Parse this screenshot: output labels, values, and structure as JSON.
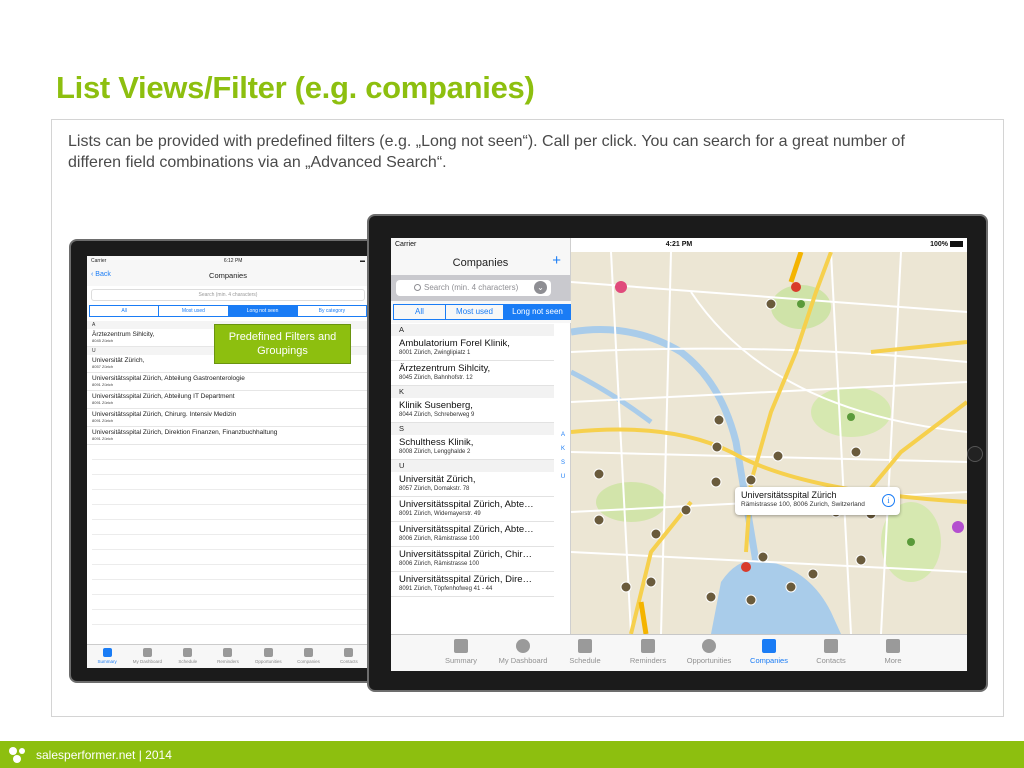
{
  "slide": {
    "title": "List Views/Filter (e.g. companies)",
    "intro": "Lists can be provided with predefined filters (e.g. „Long not seen“). Call per click. You can search for a great number of differen field combinations via an „Advanced Search“.",
    "callout": "Predefined Filters and Groupings",
    "footer": "salesperformer.net  |  2014"
  },
  "small_ipad": {
    "status_left": "Carrier",
    "status_time": "6:12 PM",
    "back_label": "Back",
    "title": "Companies",
    "search_placeholder": "Search (min. 4 characters)",
    "segments": [
      "All",
      "Most used",
      "Long not seen",
      "By category"
    ],
    "active_segment": 2,
    "sections": [
      {
        "header": "A",
        "rows": [
          {
            "name": "Ärztezentrum Sihlcity,",
            "address": "8045 Zürich"
          }
        ]
      },
      {
        "header": "U",
        "rows": [
          {
            "name": "Universität Zürich,",
            "address": "8057 Zürich"
          },
          {
            "name": "Universitätsspital Zürich, Abteilung Gastroenterologie",
            "address": "8091 Zürich"
          },
          {
            "name": "Universitätsspital Zürich, Abteilung IT Department",
            "address": "8091 Zürich"
          },
          {
            "name": "Universitätsspital Zürich, Chirurg. Intensiv Medizin",
            "address": "8091 Zürich"
          },
          {
            "name": "Universitätsspital Zürich, Direktion Finanzen, Finanzbuchhaltung",
            "address": "8091 Zürich"
          }
        ]
      }
    ],
    "tabs": [
      "Summary",
      "My Dashboard",
      "Schedule",
      "Reminders",
      "Opportunities",
      "Companies",
      "Contacts"
    ],
    "active_tab": 0
  },
  "large_ipad": {
    "status_left": "Carrier",
    "status_time": "4:21 PM",
    "status_battery": "100%",
    "title": "Companies",
    "add_icon": "plus-icon",
    "search_placeholder": "Search (min. 4 characters)",
    "segments": [
      "All",
      "Most used",
      "Long not seen"
    ],
    "active_segment": 2,
    "sections": [
      {
        "header": "A",
        "rows": [
          {
            "name": "Ambulatorium Forel Klinik,",
            "address": "8001 Zürich, Zwinglipiatz 1"
          },
          {
            "name": "Ärztezentrum Sihlcity,",
            "address": "8045 Zürich, Bahnhofstr. 12"
          }
        ]
      },
      {
        "header": "K",
        "rows": [
          {
            "name": "Klinik Susenberg,",
            "address": "8044 Zürich, Schreberweg 9"
          }
        ]
      },
      {
        "header": "S",
        "rows": [
          {
            "name": "Schulthess Klinik,",
            "address": "8008 Zürich, Lengghalde 2"
          }
        ]
      },
      {
        "header": "U",
        "rows": [
          {
            "name": "Universität Zürich,",
            "address": "8057 Zürich, Domakstr. 78"
          },
          {
            "name": "Universitätsspital Zürich, Abte…",
            "address": "8091 Zürich, Widemayerstr. 49"
          },
          {
            "name": "Universitätsspital Zürich, Abte…",
            "address": "8006 Zürich, Rämistrasse 100"
          },
          {
            "name": "Universitätsspital Zürich, Chir…",
            "address": "8006  Zürich, Rämistrasse 100"
          },
          {
            "name": "Universitätsspital Zürich, Dire…",
            "address": "8091 Zürich, Töpfenhofweg 41 - 44"
          }
        ]
      }
    ],
    "index_letters": [
      "A",
      "K",
      "S",
      "U"
    ],
    "map_callout": {
      "title": "Universitätsspital Zürich",
      "subtitle": "Rämistrasse 100, 8006 Zurich, Switzerland"
    },
    "tabs": [
      "Summary",
      "My Dashboard",
      "Schedule",
      "Reminders",
      "Opportunities",
      "Companies",
      "Contacts",
      "More"
    ],
    "active_tab": 5
  },
  "colors": {
    "accent": "#8dbf0f",
    "ios_blue": "#1a7cf5"
  }
}
